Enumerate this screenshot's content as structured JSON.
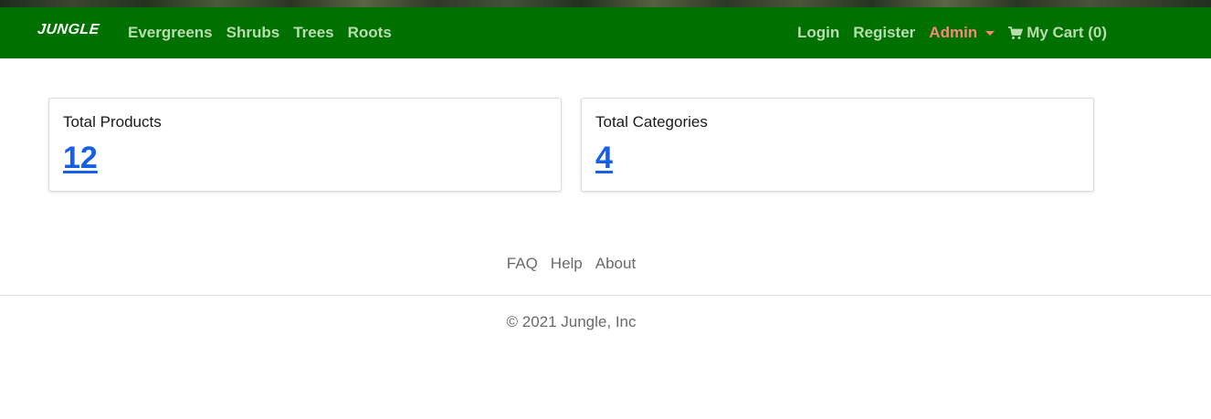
{
  "app": {
    "brand": "JUNGLE",
    "accent_color": "#007000",
    "link_color": "#1560e6"
  },
  "nav": {
    "categories": [
      "Evergreens",
      "Shrubs",
      "Trees",
      "Roots"
    ],
    "login": "Login",
    "register": "Register",
    "admin": "Admin",
    "admin_color": "#f28c7a",
    "cart": "My Cart (0)",
    "cart_icon": "shopping-cart-icon"
  },
  "dashboard": {
    "products": {
      "label": "Total Products",
      "value": "12"
    },
    "categories": {
      "label": "Total Categories",
      "value": "4"
    }
  },
  "footer": {
    "links": [
      "FAQ",
      "Help",
      "About"
    ],
    "copyright": "© 2021 Jungle, Inc"
  }
}
